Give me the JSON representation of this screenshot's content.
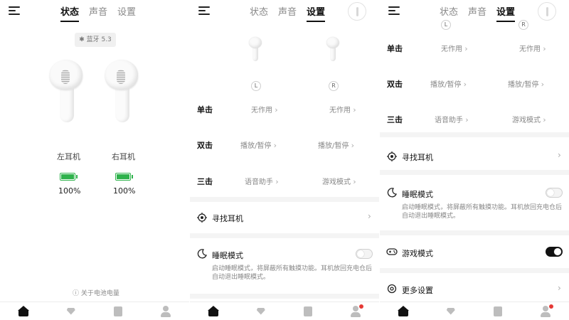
{
  "panel1": {
    "tabs": [
      "状态",
      "声音",
      "设置"
    ],
    "active_tab": 0,
    "bluetooth": "✱ 蓝牙 5.3",
    "left": {
      "label": "左耳机",
      "battery": "100%",
      "level": 1.0
    },
    "right": {
      "label": "右耳机",
      "battery": "100%",
      "level": 1.0
    },
    "about": "ⓘ 关于电池电量"
  },
  "panel2": {
    "tabs": [
      "状态",
      "声音",
      "设置"
    ],
    "active_tab": 2,
    "left_badge": "L",
    "right_badge": "R",
    "rows": [
      {
        "title": "单击",
        "left": "无作用",
        "right": "无作用"
      },
      {
        "title": "双击",
        "left": "播放/暂停",
        "right": "播放/暂停"
      },
      {
        "title": "三击",
        "left": "语音助手",
        "right": "游戏模式"
      }
    ],
    "find": "寻找耳机",
    "sleep": {
      "title": "睡眠模式",
      "desc": "启动睡眠模式，将屏蔽所有触摸功能。耳机放回充电仓后自动退出睡眠模式。",
      "on": false
    }
  },
  "panel3": {
    "tabs": [
      "状态",
      "声音",
      "设置"
    ],
    "active_tab": 2,
    "left_badge": "L",
    "right_badge": "R",
    "rows": [
      {
        "title": "单击",
        "left": "无作用",
        "right": "无作用"
      },
      {
        "title": "双击",
        "left": "播放/暂停",
        "right": "播放/暂停"
      },
      {
        "title": "三击",
        "left": "语音助手",
        "right": "游戏模式"
      }
    ],
    "find": "寻找耳机",
    "sleep": {
      "title": "睡眠模式",
      "desc": "启动睡眠模式，将屏蔽所有触摸功能。耳机放回充电仓后自动退出睡眠模式。",
      "on": false
    },
    "game": {
      "title": "游戏模式",
      "on": true
    },
    "more": "更多设置"
  },
  "chevron": "›",
  "colors": {
    "battery": "#2fb24c",
    "badge": "#e53935",
    "toggle_on": "#111111"
  }
}
